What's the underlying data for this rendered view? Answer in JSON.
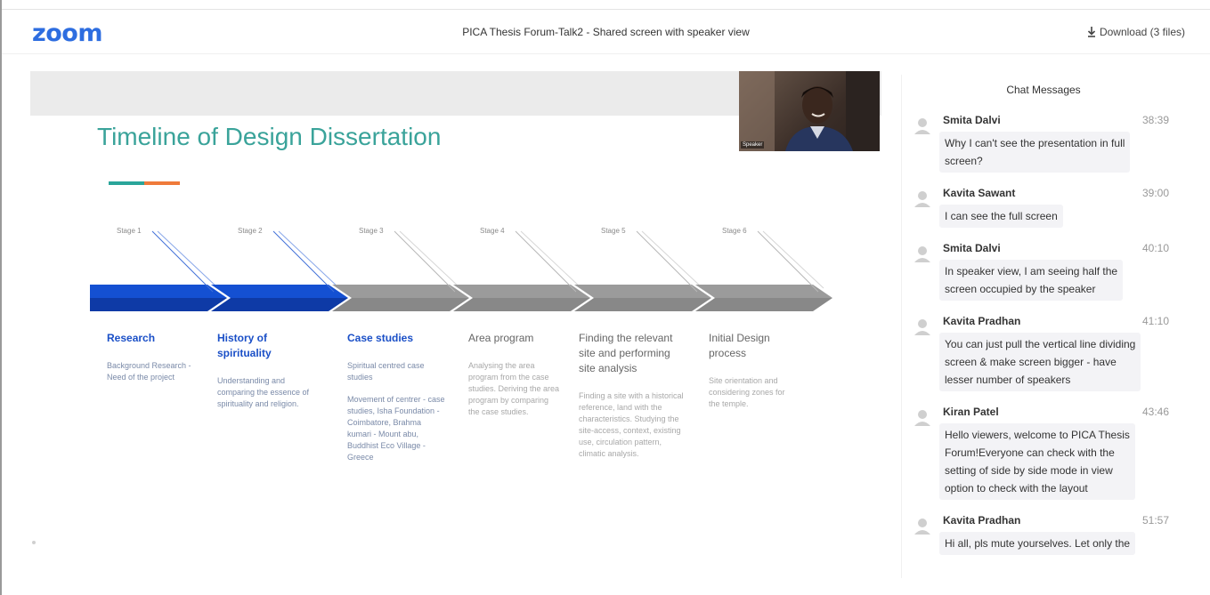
{
  "header": {
    "logo": "zoom",
    "title": "PICA Thesis Forum-Talk2 - Shared screen with speaker view",
    "download_label": "Download (3 files)"
  },
  "slide": {
    "title": "Timeline of Design Dissertation",
    "stage_labels": [
      "Stage 1",
      "Stage 2",
      "Stage 3",
      "Stage 4",
      "Stage 5",
      "Stage 6"
    ],
    "stages": [
      {
        "heading": "Research",
        "desc": "Background Research - Need of the project",
        "desc2": ""
      },
      {
        "heading": "History of spirituality",
        "desc": "Understanding and comparing the essence of spirituality and religion.",
        "desc2": ""
      },
      {
        "heading": "Case studies",
        "desc": "Spiritual centred case studies",
        "desc2": "Movement of centrer - case studies, Isha Foundation - Coimbatore, Brahma kumari - Mount abu, Buddhist Eco Village - Greece"
      },
      {
        "heading": "Area program",
        "desc": "Analysing the area program from the case studies. Deriving the area program by comparing the case studies.",
        "desc2": ""
      },
      {
        "heading": "Finding the relevant site and performing site analysis",
        "desc": "Finding a site with a historical reference, land with the characteristics. Studying the site-access, context, existing use, circulation pattern, climatic analysis.",
        "desc2": ""
      },
      {
        "heading": "Initial Design process",
        "desc": "Site orientation and considering zones for the temple.",
        "desc2": ""
      }
    ]
  },
  "video": {
    "speaker_name": "Speaker"
  },
  "chat": {
    "title": "Chat Messages",
    "messages": [
      {
        "sender": "Smita Dalvi",
        "time": "38:39",
        "lines": [
          "Why I can't see the presentation in full",
          "screen?"
        ]
      },
      {
        "sender": "Kavita Sawant",
        "time": "39:00",
        "lines": [
          "I can see the full screen"
        ]
      },
      {
        "sender": "Smita Dalvi",
        "time": "40:10",
        "lines": [
          "In speaker view, I am seeing half the",
          "screen occupied by the speaker"
        ]
      },
      {
        "sender": "Kavita Pradhan",
        "time": "41:10",
        "lines": [
          "You can just pull the vertical line dividing",
          "screen & make screen bigger - have",
          "lesser number of speakers"
        ]
      },
      {
        "sender": "Kiran Patel",
        "time": "43:46",
        "lines": [
          "Hello viewers, welcome to PICA Thesis",
          "Forum!Everyone can check with the",
          "setting of side by side mode in view",
          "option to check with the layout"
        ]
      },
      {
        "sender": "Kavita Pradhan",
        "time": "51:57",
        "lines": [
          "Hi all, pls mute yourselves. Let only the"
        ]
      }
    ]
  },
  "colors": {
    "brand_blue": "#2d6de0",
    "slide_title": "#3aa39a",
    "arrow_blue": "#1450d2",
    "arrow_grey": "#9b9b9b",
    "stage_blue_text": "#1a4fc7"
  }
}
